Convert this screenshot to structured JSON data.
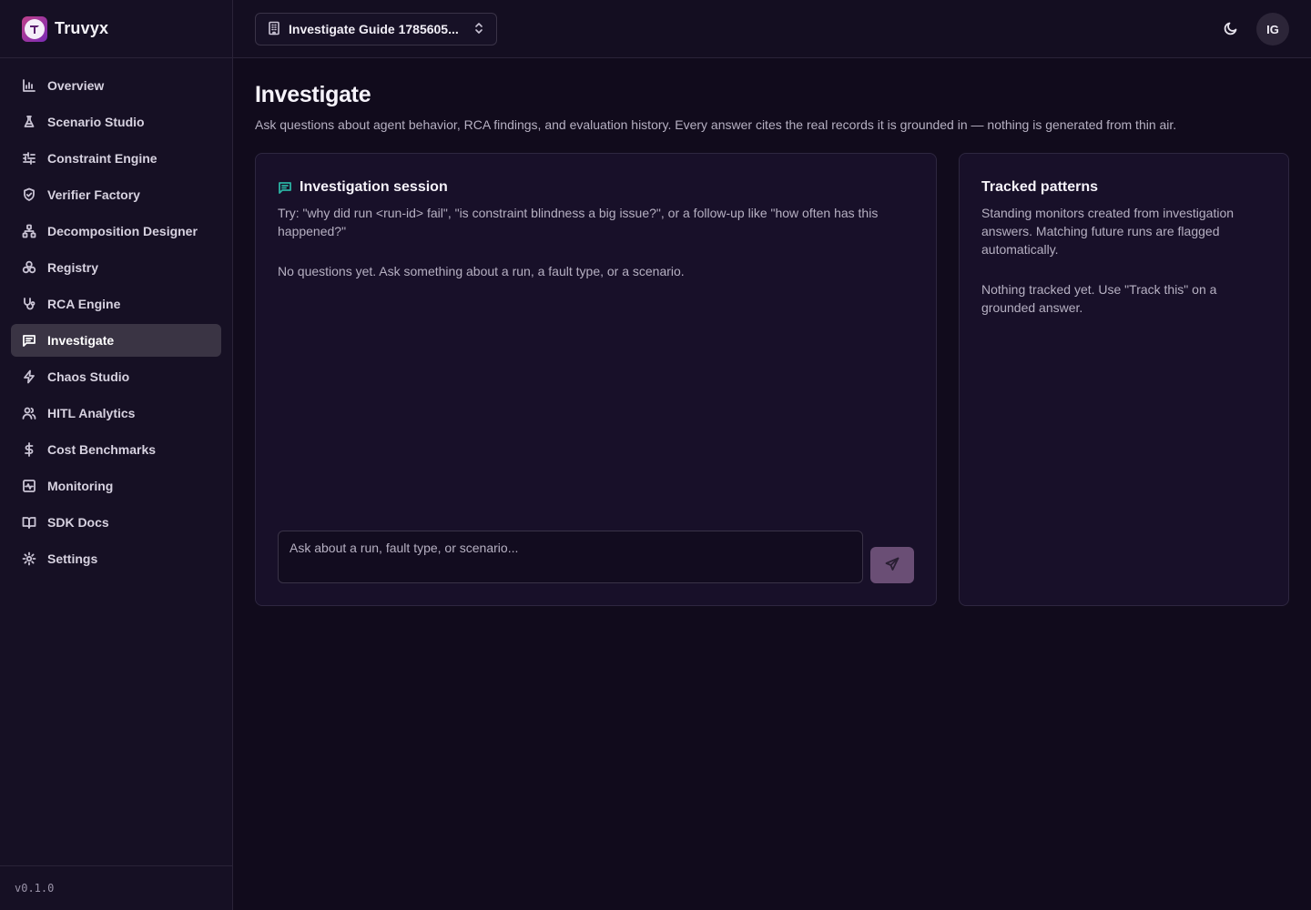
{
  "brand": {
    "name": "Truvyx"
  },
  "sidebar": {
    "items": [
      {
        "label": "Overview",
        "icon": "bar-chart-icon"
      },
      {
        "label": "Scenario Studio",
        "icon": "flask-icon"
      },
      {
        "label": "Constraint Engine",
        "icon": "sliders-icon"
      },
      {
        "label": "Verifier Factory",
        "icon": "shield-check-icon"
      },
      {
        "label": "Decomposition Designer",
        "icon": "network-icon"
      },
      {
        "label": "Registry",
        "icon": "boxes-icon"
      },
      {
        "label": "RCA Engine",
        "icon": "stethoscope-icon"
      },
      {
        "label": "Investigate",
        "icon": "message-square-icon",
        "active": true
      },
      {
        "label": "Chaos Studio",
        "icon": "zap-icon"
      },
      {
        "label": "HITL Analytics",
        "icon": "users-icon"
      },
      {
        "label": "Cost Benchmarks",
        "icon": "dollar-icon"
      },
      {
        "label": "Monitoring",
        "icon": "activity-icon"
      },
      {
        "label": "SDK Docs",
        "icon": "book-icon"
      },
      {
        "label": "Settings",
        "icon": "gear-icon"
      }
    ],
    "version": "v0.1.0"
  },
  "topbar": {
    "workspace": "Investigate Guide 1785605...",
    "avatar_initials": "IG"
  },
  "page": {
    "title": "Investigate",
    "subtitle": "Ask questions about agent behavior, RCA findings, and evaluation history. Every answer cites the real records it is grounded in — nothing is generated from thin air."
  },
  "session": {
    "title": "Investigation session",
    "hint": "Try: \"why did run <run-id> fail\", \"is constraint blindness a big issue?\", or a follow-up like \"how often has this happened?\"",
    "empty": "No questions yet. Ask something about a run, a fault type, or a scenario.",
    "input_placeholder": "Ask about a run, fault type, or scenario..."
  },
  "patterns": {
    "title": "Tracked patterns",
    "description": "Standing monitors created from investigation answers. Matching future runs are flagged automatically.",
    "empty": "Nothing tracked yet. Use \"Track this\" on a grounded answer."
  },
  "colors": {
    "accent_teal": "#2bb3a3",
    "send_button": "#6a4e75",
    "active_nav": "#3a3444"
  }
}
